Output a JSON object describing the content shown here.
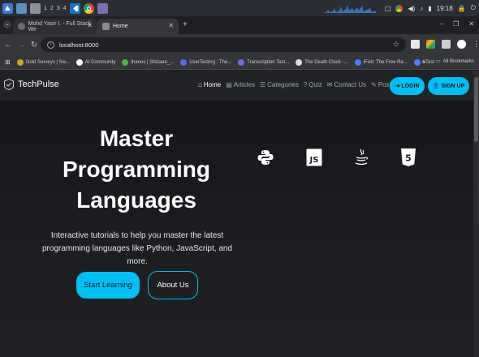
{
  "taskbar": {
    "workspaces": [
      "1",
      "2",
      "3",
      "4"
    ],
    "clock": "19:18"
  },
  "browser": {
    "tabs": [
      {
        "label": "Mohd Yasir I. - Full Stack We",
        "active": false
      },
      {
        "label": "Home",
        "active": true
      }
    ],
    "url": "localhost:8000",
    "bookmarks": [
      "Gold Surveys | Sw...",
      "AI Community",
      "thanos | Shizaan_...",
      "UserTesting : The...",
      "Transcription Test...",
      "The Death Clock -...",
      "iFixit: The Free Re...",
      "uTest"
    ],
    "all_bookmarks": "All Bookmarks"
  },
  "site": {
    "brand": "TechPulse",
    "nav": [
      {
        "label": "Home",
        "icon": "home-icon",
        "active": true
      },
      {
        "label": "Articles",
        "icon": "article-icon",
        "active": false
      },
      {
        "label": "Categories",
        "icon": "list-icon",
        "active": false
      },
      {
        "label": "Quiz",
        "icon": "question-icon",
        "active": false
      },
      {
        "label": "Contact Us",
        "icon": "envelope-icon",
        "active": false
      },
      {
        "label": "Post",
        "icon": "pencil-icon",
        "active": false
      }
    ],
    "login_label": "LOGIN",
    "signup_label": "SIGN UP",
    "accent": "#00c0f3"
  },
  "hero": {
    "title_line1": "Master",
    "title_line2": "Programming",
    "title_line3": "Languages",
    "subtitle_line1": "Interactive tutorials to help you master the latest",
    "subtitle_line2": "programming languages like Python, JavaScript, and more.",
    "primary_cta": "Start Learning",
    "secondary_cta": "About Us",
    "language_icons": [
      "python-icon",
      "javascript-icon",
      "java-icon",
      "html5-icon"
    ]
  }
}
